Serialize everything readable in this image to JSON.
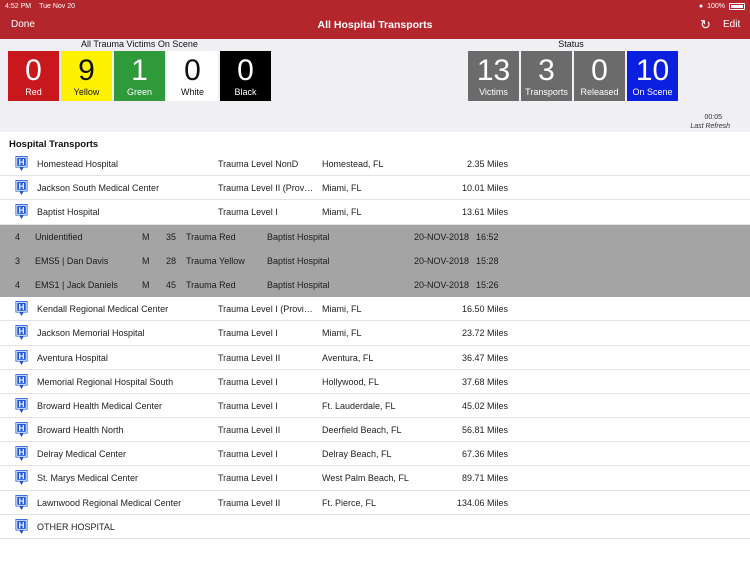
{
  "statusbar": {
    "time": "4:52 PM",
    "date": "Tue Nov 20",
    "battery": "100%"
  },
  "nav": {
    "done": "Done",
    "title": "All Hospital Transports",
    "edit": "Edit"
  },
  "victims_group": {
    "label": "All Trauma Victims On Scene",
    "tiles": [
      {
        "value": "0",
        "label": "Red",
        "bg": "#c8171d",
        "fg": "#ffffff"
      },
      {
        "value": "9",
        "label": "Yellow",
        "bg": "#fff200",
        "fg": "#111111"
      },
      {
        "value": "1",
        "label": "Green",
        "bg": "#2f9a3a",
        "fg": "#ffffff"
      },
      {
        "value": "0",
        "label": "White",
        "bg": "#ffffff",
        "fg": "#111111"
      },
      {
        "value": "0",
        "label": "Black",
        "bg": "#000000",
        "fg": "#ffffff"
      }
    ]
  },
  "status_group": {
    "label": "Status",
    "tiles": [
      {
        "value": "13",
        "label": "Victims",
        "bg": "#6b6b6b",
        "fg": "#ffffff"
      },
      {
        "value": "3",
        "label": "Transports",
        "bg": "#6b6b6b",
        "fg": "#ffffff"
      },
      {
        "value": "0",
        "label": "Released",
        "bg": "#6b6b6b",
        "fg": "#ffffff"
      },
      {
        "value": "10",
        "label": "On Scene",
        "bg": "#0a1fe0",
        "fg": "#ffffff"
      }
    ]
  },
  "refresh": {
    "time": "00:05",
    "label": "Last Refresh"
  },
  "section_title": "Hospital Transports",
  "rows": [
    {
      "kind": "hosp",
      "name": "Homestead Hospital",
      "level": "Trauma Level NonD",
      "city": "Homestead, FL",
      "dist": "2.35 Miles"
    },
    {
      "kind": "hosp",
      "name": "Jackson South Medical Center",
      "level": "Trauma Level II (Provisional)",
      "city": "Miami, FL",
      "dist": "10.01 Miles"
    },
    {
      "kind": "hosp",
      "name": "Baptist Hospital",
      "level": "Trauma Level I",
      "city": "Miami, FL",
      "dist": "13.61 Miles"
    },
    {
      "kind": "patient",
      "idx": "4",
      "name": "Unidentified",
      "sex": "M",
      "age": "35",
      "tag": "Trauma Red",
      "dest": "Baptist Hospital",
      "date": "20-NOV-2018",
      "time": "16:52"
    },
    {
      "kind": "patient",
      "idx": "3",
      "name": "EMS5 | Dan Davis",
      "sex": "M",
      "age": "28",
      "tag": "Trauma Yellow",
      "dest": "Baptist Hospital",
      "date": "20-NOV-2018",
      "time": "15:28"
    },
    {
      "kind": "patient",
      "idx": "4",
      "name": "EMS1 | Jack Daniels",
      "sex": "M",
      "age": "45",
      "tag": "Trauma Red",
      "dest": "Baptist Hospital",
      "date": "20-NOV-2018",
      "time": "15:26"
    },
    {
      "kind": "hosp",
      "name": "Kendall Regional Medical Center",
      "level": "Trauma Level I (Provisional)",
      "city": "Miami, FL",
      "dist": "16.50 Miles"
    },
    {
      "kind": "hosp",
      "name": "Jackson Memorial Hospital",
      "level": "Trauma Level I",
      "city": "Miami, FL",
      "dist": "23.72 Miles"
    },
    {
      "kind": "hosp",
      "name": "Aventura Hospital",
      "level": "Trauma Level II",
      "city": "Aventura, FL",
      "dist": "36.47 Miles"
    },
    {
      "kind": "hosp",
      "name": "Memorial Regional Hospital South",
      "level": "Trauma Level I",
      "city": "Hollywood, FL",
      "dist": "37.68 Miles"
    },
    {
      "kind": "hosp",
      "name": "Broward Health Medical Center",
      "level": "Trauma Level I",
      "city": "Ft. Lauderdale, FL",
      "dist": "45.02 Miles"
    },
    {
      "kind": "hosp",
      "name": "Broward Health North",
      "level": "Trauma Level II",
      "city": "Deerfield Beach, FL",
      "dist": "56.81 Miles"
    },
    {
      "kind": "hosp",
      "name": "Delray Medical Center",
      "level": "Trauma Level I",
      "city": "Delray Beach, FL",
      "dist": "67.36 Miles"
    },
    {
      "kind": "hosp",
      "name": "St. Marys Medical Center",
      "level": "Trauma Level I",
      "city": "West Palm Beach, FL",
      "dist": "89.71 Miles"
    },
    {
      "kind": "hosp",
      "name": "Lawnwood Regional Medical Center",
      "level": "Trauma Level II",
      "city": "Ft. Pierce, FL",
      "dist": "134.06 Miles"
    },
    {
      "kind": "hosp",
      "name": "OTHER HOSPITAL",
      "level": "",
      "city": "",
      "dist": ""
    }
  ],
  "icons": {
    "hospital": "hospital-pin-icon",
    "refresh": "refresh-icon",
    "wifi": "wifi-icon",
    "battery": "battery-icon"
  },
  "colors": {
    "navbar": "#b3262c",
    "hospital_icon": "#1f56d6",
    "patient_row": "#a4a4a4"
  }
}
